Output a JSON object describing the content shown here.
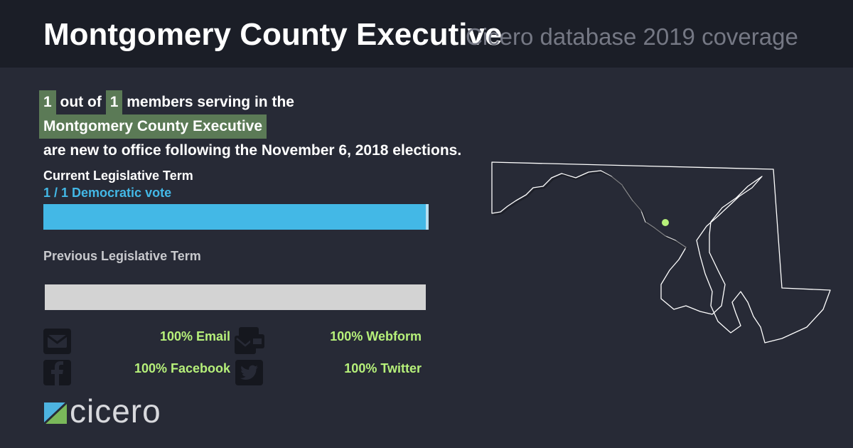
{
  "header": {
    "title": "Montgomery County Executive",
    "subtitle": "Cicero database 2019 coverage"
  },
  "summary": {
    "count_new": "1",
    "text_out_of": "out of",
    "count_total": "1",
    "text_members": "members serving in the",
    "body_name": "Montgomery County Executive",
    "text_closing": "are new to office following the November 6, 2018 elections."
  },
  "current_term": {
    "label": "Current Legislative Term",
    "vote_text": "1 / 1 Democratic vote",
    "democratic_fraction": 1.0,
    "bar_color": "#43b8e6"
  },
  "previous_term": {
    "label": "Previous Legislative Term",
    "bar_color": "#d3d3d3"
  },
  "coverage": {
    "email": "100% Email",
    "webform": "100% Webform",
    "facebook": "100% Facebook",
    "twitter": "100% Twitter"
  },
  "icons": {
    "email": "envelope-icon",
    "webform": "webform-icon",
    "facebook": "facebook-icon",
    "twitter": "twitter-icon"
  },
  "brand": {
    "logo_text": "cicero"
  },
  "colors": {
    "background": "#272a36",
    "header": "#1b1e27",
    "highlight": "#5b7a56",
    "stat_green": "#b6f07a",
    "democratic_blue": "#43b8e6"
  }
}
